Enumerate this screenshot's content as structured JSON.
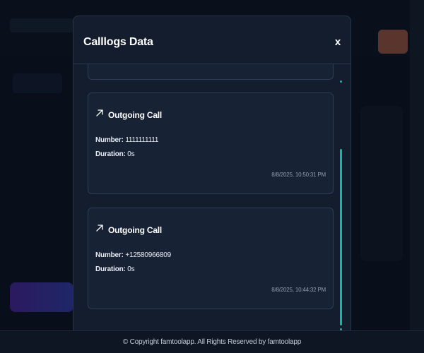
{
  "modal": {
    "title": "Calllogs Data",
    "close_label": "x"
  },
  "call_logs": [
    {
      "type": "Outgoing Call",
      "number_label": "Number:",
      "number": "1111111111",
      "duration_label": "Duration:",
      "duration": "0s",
      "timestamp": "8/8/2025, 10:50:31 PM",
      "icon": "outgoing-call-arrow-icon"
    },
    {
      "type": "Outgoing Call",
      "number_label": "Number:",
      "number": "+12580966809",
      "duration_label": "Duration:",
      "duration": "0s",
      "timestamp": "8/8/2025, 10:44:32 PM",
      "icon": "outgoing-call-arrow-icon"
    }
  ],
  "footer": {
    "text": "© Copyright famtoolapp. All Rights Reserved by famtoolapp"
  },
  "colors": {
    "accent": "#14b8a6",
    "modal_bg": "#141d2e",
    "card_bg": "#182235"
  }
}
